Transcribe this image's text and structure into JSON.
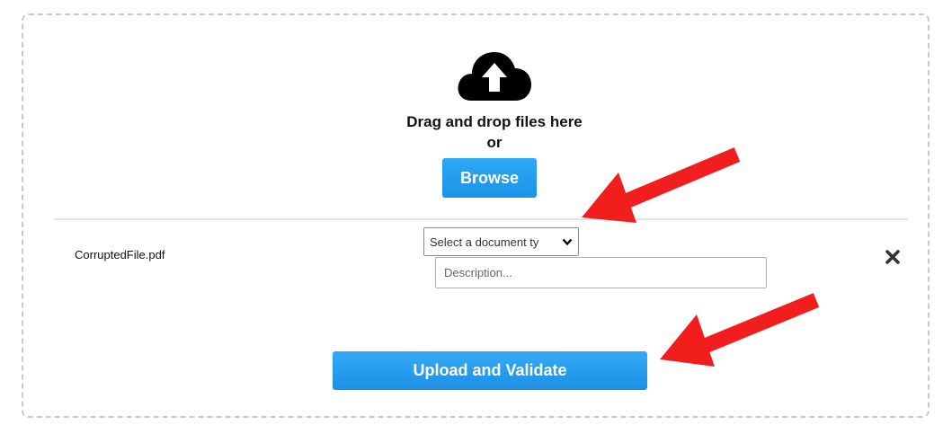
{
  "dropzone": {
    "drag_text": "Drag and drop files here",
    "or_text": "or",
    "browse_label": "Browse",
    "icon": "cloud-upload-icon"
  },
  "file_row": {
    "file_name": "CorruptedFile.pdf",
    "document_type_selected": "Select a document ty",
    "description_placeholder": "Description...",
    "remove_icon": "close-icon"
  },
  "actions": {
    "upload_label": "Upload and Validate"
  },
  "colors": {
    "button_blue": "#1d92e8",
    "arrow_red": "#f21d1d"
  }
}
